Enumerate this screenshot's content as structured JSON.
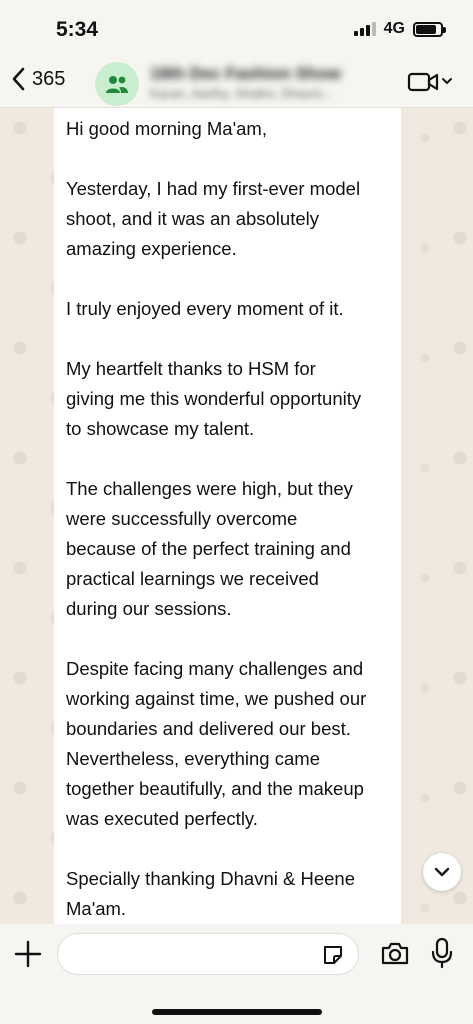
{
  "status_bar": {
    "time": "5:34",
    "network": "4G"
  },
  "header": {
    "back_count": "365",
    "group_title": "18th Dec Fashion Show",
    "group_subtitle": "Karan, Aarthy, Shalini, Dhavni..."
  },
  "message": {
    "lines": [
      "Hi good morning Ma'am,",
      "",
      "Yesterday, I had my first-ever model",
      "shoot, and it was an absolutely",
      "amazing experience.",
      "",
      "I truly enjoyed every moment of it.",
      "",
      "My heartfelt thanks to HSM for",
      "giving me this wonderful opportunity",
      "to showcase my talent.",
      "",
      "The challenges were high, but they",
      "were successfully overcome",
      "because of the perfect training and",
      "practical learnings we received",
      "during our sessions.",
      "",
      "Despite facing many challenges and",
      "working against time, we pushed our",
      "boundaries and delivered our best.",
      "Nevertheless, everything came",
      "together beautifully, and the makeup",
      "was executed perfectly.",
      "",
      "Specially thanking Dhavni & Heene",
      "Ma'am."
    ]
  },
  "composer": {
    "value": "",
    "placeholder": ""
  },
  "icons": {
    "back": "chevron-left-icon",
    "group": "group-icon",
    "video": "video-camera-icon",
    "scroll": "chevron-down-icon",
    "plus": "plus-icon",
    "sticker": "sticker-icon",
    "camera": "camera-icon",
    "mic": "microphone-icon"
  },
  "colors": {
    "avatar_bg": "#c9eecf",
    "avatar_icon": "#1f8a3b",
    "bubble": "#ffffff",
    "wallpaper": "#efe9e0"
  }
}
